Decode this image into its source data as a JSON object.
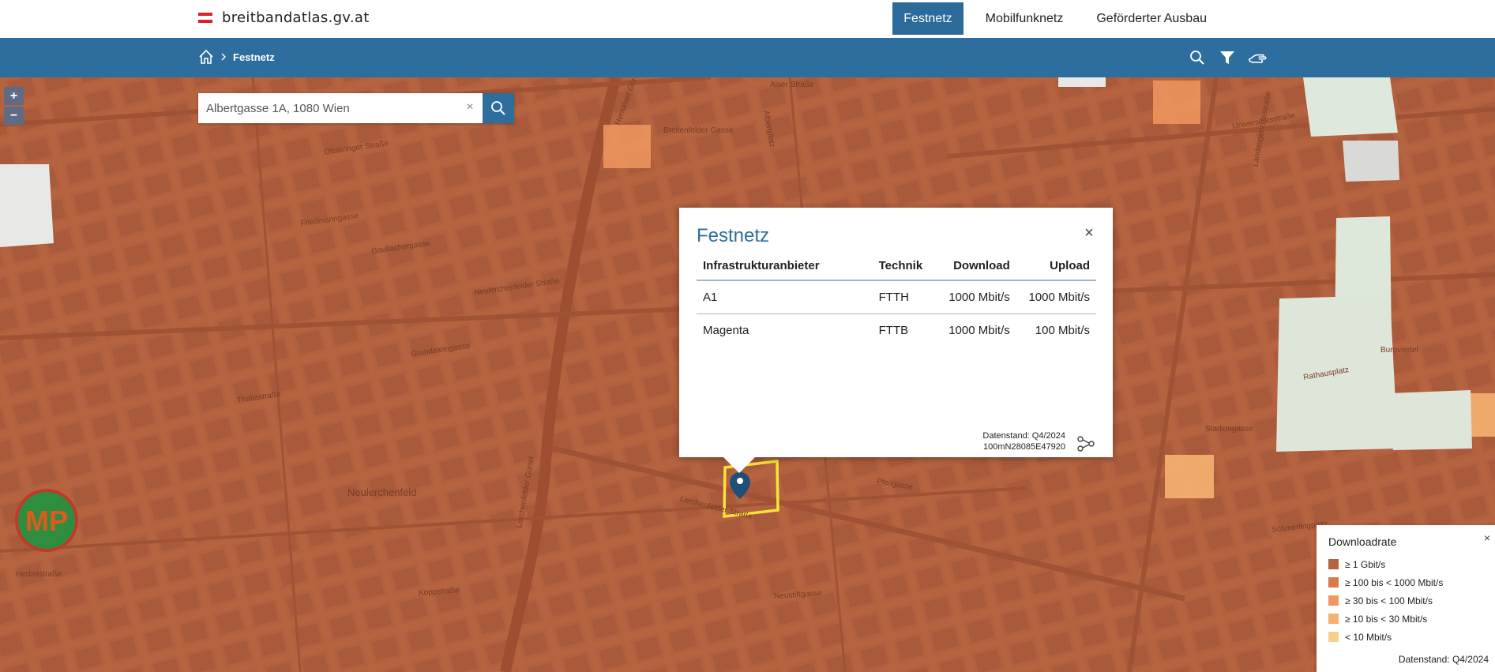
{
  "header": {
    "site_name": "breitbandatlas.gv.at",
    "nav": [
      {
        "label": "Festnetz",
        "active": true
      },
      {
        "label": "Mobilfunknetz",
        "active": false
      },
      {
        "label": "Geförderter Ausbau",
        "active": false
      }
    ]
  },
  "breadcrumb": {
    "current": "Festnetz"
  },
  "toolbar": {
    "icons": [
      "search-icon",
      "filter-icon",
      "hand-icon"
    ]
  },
  "map": {
    "zoom_in": "+",
    "zoom_out": "−",
    "search": {
      "value": "Albertgasse 1A, 1080 Wien",
      "clear": "×"
    },
    "labels": [
      "Ottakringer Straße",
      "Hernalser Gürtel",
      "Alser Straße",
      "Breitenfelder Gasse",
      "Albertplatz",
      "Friedmanngasse",
      "Gaullachergasse",
      "Neulerchenfelder Straße",
      "Thaliastraße",
      "Grundsteingasse",
      "Neulerchenfeld",
      "Lerchenfelder Gürtel",
      "Lerchenfelder Straße",
      "Koppstraße",
      "Neustiftgasse",
      "Pfeilgasse",
      "Josefstädter Straße",
      "Landesgerichtsstraße",
      "Universitätsstraße",
      "Rathausplatz",
      "Burgviertel",
      "Stadiongasse",
      "Schmerlingplatz",
      "Herbststraße",
      "Thaliastraße"
    ]
  },
  "popup": {
    "title": "Festnetz",
    "close": "×",
    "columns": [
      "Infrastrukturanbieter",
      "Technik",
      "Download",
      "Upload"
    ],
    "rows": [
      {
        "provider": "A1",
        "tech": "FTTH",
        "download": "1000 Mbit/s",
        "upload": "1000 Mbit/s"
      },
      {
        "provider": "Magenta",
        "tech": "FTTB",
        "download": "1000 Mbit/s",
        "upload": "100 Mbit/s"
      }
    ],
    "datenstand": "Datenstand: Q4/2024",
    "cell_id": "100mN28085E47920"
  },
  "legend": {
    "title": "Downloadrate",
    "close": "×",
    "items": [
      {
        "label": "≥ 1 Gbit/s",
        "color": "#b5643f"
      },
      {
        "label": "≥ 100 bis < 1000 Mbit/s",
        "color": "#d97a4e"
      },
      {
        "label": "≥ 30 bis < 100 Mbit/s",
        "color": "#f0985f"
      },
      {
        "label": "≥ 10 bis < 30 Mbit/s",
        "color": "#f5b171"
      },
      {
        "label": "< 10 Mbit/s",
        "color": "#f8d08d"
      }
    ],
    "datenstand": "Datenstand: Q4/2024"
  },
  "watermark": {
    "text": "MP"
  }
}
